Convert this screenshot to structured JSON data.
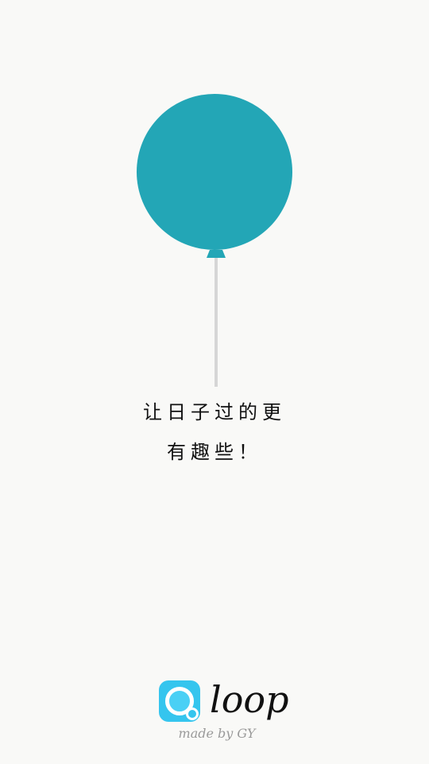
{
  "colors": {
    "background": "#f9f9f7",
    "balloon": "#23a6b6",
    "string": "#d6d6d6",
    "app_icon": "#35c5ee"
  },
  "illustration": {
    "icon": "balloon-icon"
  },
  "tagline": {
    "line1": "让日子过的更",
    "line2": "有趣些！"
  },
  "brand": {
    "icon": "loop-logo-icon",
    "name": "loop",
    "credit": "made by GY"
  }
}
